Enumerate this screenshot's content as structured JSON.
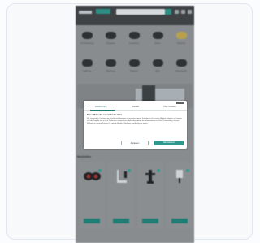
{
  "page": {
    "header": {
      "logo_text": "",
      "search_placeholder": ""
    },
    "categories": [
      {
        "label": "Schutzkleidung"
      },
      {
        "label": "Reinigung"
      },
      {
        "label": "Verpackung"
      },
      {
        "label": "Elektro"
      },
      {
        "label": "Sicherheit"
      },
      {
        "label": "Lagerung"
      },
      {
        "label": "Werkzeug"
      },
      {
        "label": "Transport"
      },
      {
        "label": "Büro"
      },
      {
        "label": "Messtechnik"
      }
    ],
    "hero": {
      "title": ""
    },
    "section_title": "Neuheiten",
    "products": [
      {
        "name": "",
        "price": ""
      },
      {
        "name": "",
        "price": ""
      },
      {
        "name": "",
        "price": ""
      },
      {
        "name": "",
        "price": ""
      }
    ],
    "footer_hint": ""
  },
  "consent_modal": {
    "tabs": [
      {
        "label": "Zustimmung"
      },
      {
        "label": "Details"
      },
      {
        "label": "Über Cookies"
      }
    ],
    "heading": "Diese Webseite verwendet Cookies",
    "body": "Wir verwenden Cookies, um Inhalte und Anzeigen zu personalisieren, Funktionen für soziale Medien anbieten zu können und die Zugriffe auf unsere Website zu analysieren. Außerdem geben wir Informationen zu Ihrer Verwendung unserer Website an unsere Partner für soziale Medien, Werbung und Analysen weiter.",
    "buttons": {
      "secondary": "Anpassen",
      "primary": "Alle zulassen"
    }
  },
  "colors": {
    "accent": "#2b9a8d",
    "overlay_bg": "#888c8f"
  }
}
